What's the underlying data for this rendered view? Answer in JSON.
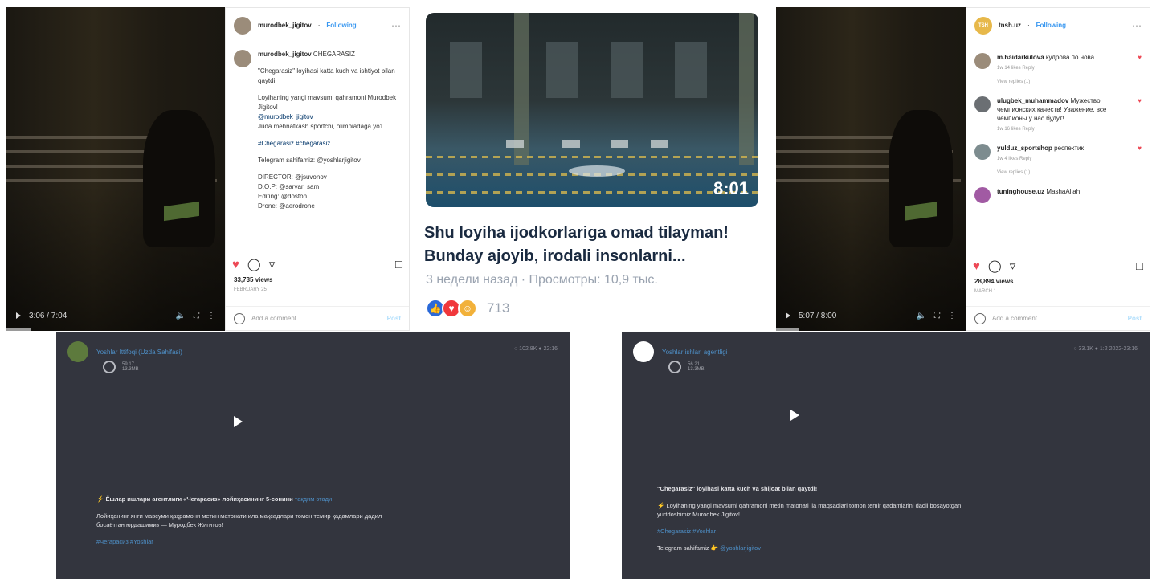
{
  "left_video": {
    "time": "3:06 / 7:04"
  },
  "left_ig": {
    "username": "murodbek_jigitov",
    "follow": "Following",
    "caption_user": "murodbek_jigitov",
    "caption_tag": "CHEGARASIZ",
    "caption": [
      "\"Chegarasiz\" loyihasi katta kuch va ishtiyot bilan qaytdi!",
      "Loyihaning yangi mavsumi qahramoni Murodbek Jigitov!",
      "@murodbek_jigitov",
      "Juda mehnatkash sportchi, olimpiadaga yo'l",
      "#Chegarasiz #chegarasiz",
      "Telegram sahifamiz: @yoshlarjigitov",
      "DIRECTOR: @jsuvonov",
      "D.O.P: @sarvar_sam",
      "Editing: @doston",
      "Drone: @aerodrone"
    ],
    "views": "33,735 views",
    "ago": "FEBRUARY 25",
    "add_comment": "Add a comment...",
    "post": "Post"
  },
  "center": {
    "duration": "8:01",
    "title": "Shu loyiha ijodkorlariga omad tilayman! Bunday ajoyib, irodali insonlarni...",
    "meta": "3 недели назад · Просмотры: 10,9 тыс.",
    "reactions_count": "713"
  },
  "right_video": {
    "time": "5:07 / 8:00"
  },
  "right_ig": {
    "username": "tnsh.uz",
    "follow": "Following",
    "avatar_text": "TSH",
    "comments": [
      {
        "user": "m.haidarkulova",
        "text": "кудрова по нова",
        "meta": "1w  14 likes  Reply",
        "replies": "View replies (1)"
      },
      {
        "user": "ulugbek_muhammadov",
        "text": "Мужество, чемпионских качеств! Уважение, все чемпионы у нас будут!",
        "meta": "1w  16 likes  Reply",
        "replies": ""
      },
      {
        "user": "yulduz_sportshop",
        "text": "респектик",
        "meta": "1w  4 likes  Reply",
        "replies": "View replies (1)"
      },
      {
        "user": "tuninghouse.uz",
        "text": "MashaAllah",
        "meta": "",
        "replies": ""
      }
    ],
    "views": "28,894 views",
    "ago": "MARCH 1",
    "add_comment": "Add a comment...",
    "post": "Post"
  },
  "bottom_left": {
    "channel": "Yoshlar Ittifoqi (Uzda Sahifasi)",
    "stat": "○ 102.8K  ●  22:16",
    "file_size": "59.17",
    "file_duration": "13.3MB",
    "headline": "Ёшлар ишлари агентлиги «Чегарасиз» лойиҳасининг 5-сонини",
    "headline_link": "тақдим этади",
    "body": "Лойиҳанинг янги мавсуми қаҳрамони метин матонати ила мақсадлари томон темир қадамлари дадил босаётган юрдашимиз — Муродбек Жигитов!",
    "tag": "#Чегарасиз #Yoshlar"
  },
  "bottom_right": {
    "channel": "Yoshlar ishlari agentligi",
    "stat": "○ 33.1K  ●  1:2 2022-23:16",
    "file_size": "56.21",
    "file_duration": "13.3MB",
    "headline": "\"Chegarasiz\" loyihasi katta kuch va shijoat bilan qaytdi!",
    "body": "Loyihaning yangi mavsumi qahramoni metin matonati ila maqsadlari tomon temir qadamlarini dadil bosayotgan yurtdoshimiz Murodbek Jigitov!",
    "tag": "#Chegarasiz #Yoshlar",
    "telegram": "Telegram sahifamiz",
    "telegram_link": "@yoshlarjigitov"
  },
  "colors": {
    "dark_card": "#33353e",
    "ig_heart": "#ed4956",
    "link_blue": "#4e90c8",
    "react_like": "#2a69d8",
    "react_love": "#f0383c"
  }
}
